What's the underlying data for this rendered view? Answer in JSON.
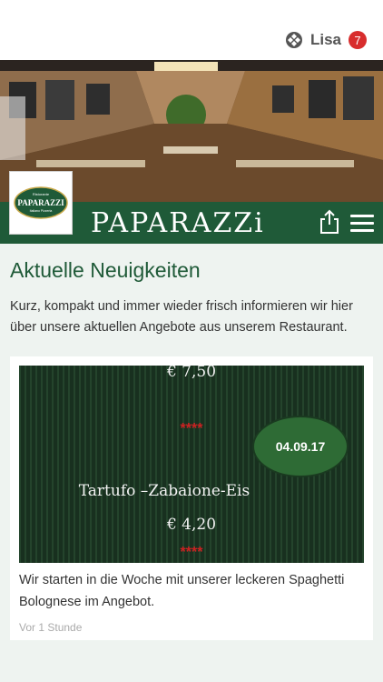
{
  "header": {
    "user_name": "Lisa",
    "notification_count": "7",
    "icons": [
      "apps-logo-icon"
    ]
  },
  "brand": {
    "name": "PAPARAZZi",
    "logo_text_top": "Ristorante",
    "logo_text_main": "PAPARAZZI",
    "logo_text_bottom": "Italiano Pizzeria",
    "color": "#1f5a38"
  },
  "toolbar": {
    "icons": [
      "share-icon",
      "menu-icon"
    ]
  },
  "news": {
    "title": "Aktuelle Neuigkeiten",
    "intro": "Kurz, kompakt und immer wieder frisch informieren wir hier über unsere aktuellen Angebote aus unserem Restaurant.",
    "items": [
      {
        "image": {
          "price_top": "€ 7,50",
          "stars": "****",
          "date": "04.09.17",
          "dish": "Tartufo –Zabaione-Eis",
          "price": "€ 4,20",
          "stars_bottom": "****"
        },
        "text": "Wir starten in die Woche mit unserer leckeren Spaghetti Bolognese im Angebot.",
        "time": "Vor 1 Stunde"
      }
    ]
  }
}
